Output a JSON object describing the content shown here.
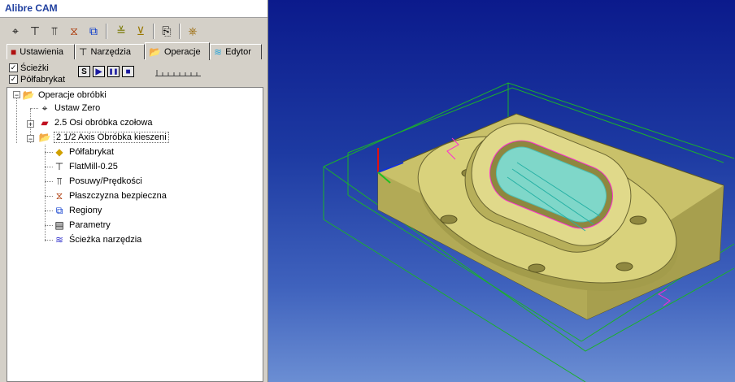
{
  "app": {
    "title": "Alibre CAM"
  },
  "toolbar": {
    "icons": [
      "probe-icon",
      "tool-icon",
      "feeds-icon",
      "plane-icon",
      "regions-icon",
      "engrave-icon",
      "pocket-icon",
      "copy-icon",
      "post-icon"
    ]
  },
  "tabs": [
    {
      "label": "Ustawienia",
      "active": false
    },
    {
      "label": "Narzędzia",
      "active": false
    },
    {
      "label": "Operacje",
      "active": true
    },
    {
      "label": "Edytor",
      "active": false
    }
  ],
  "options": {
    "toolpaths": {
      "label": "Ścieżki",
      "checked": true
    },
    "stock": {
      "label": "Półfabrykat",
      "checked": true
    },
    "sim_buttons": [
      "S",
      "▶",
      "❚❚",
      "■"
    ]
  },
  "tree": {
    "root": "Operacje obróbki",
    "items": [
      {
        "label": "Ustaw Zero",
        "level": 1
      },
      {
        "label": "2.5 Osi obróbka czołowa",
        "level": 1
      },
      {
        "label": "2 1/2 Axis Obróbka kieszeni",
        "level": 1
      },
      {
        "label": "Półfabrykat",
        "level": 2
      },
      {
        "label": "FlatMill-0.25",
        "level": 2
      },
      {
        "label": "Posuwy/Prędkości",
        "level": 2
      },
      {
        "label": "Płaszczyzna bezpieczna",
        "level": 2
      },
      {
        "label": "Regiony",
        "level": 2
      },
      {
        "label": "Parametry",
        "level": 2
      },
      {
        "label": "Ścieżka narzędzia",
        "level": 2
      }
    ]
  },
  "colors": {
    "title_text": "#1f3f9f",
    "part": "#c9c16a",
    "toolpath": "#ff2ad4",
    "wireframe": "#1bb12a",
    "background_top": "#0b1a8c",
    "background_bottom": "#6b8ed3"
  }
}
